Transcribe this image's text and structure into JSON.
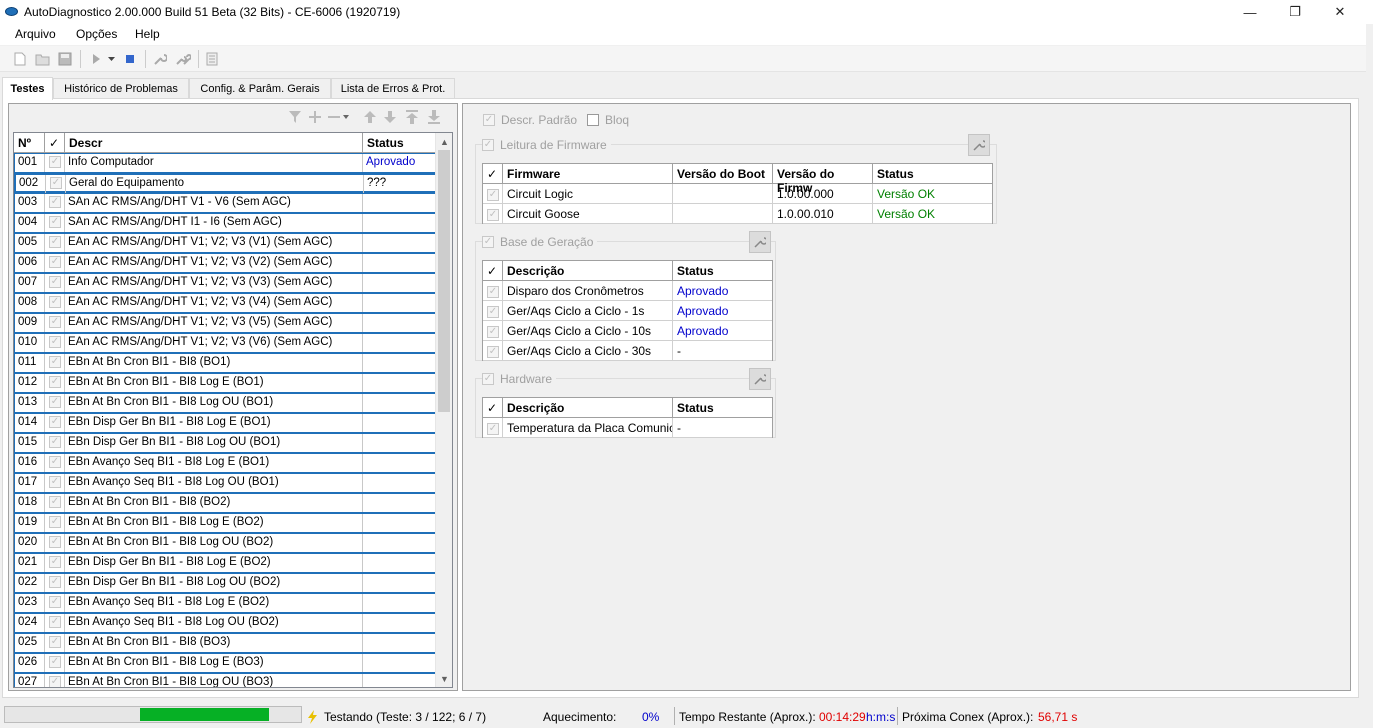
{
  "window": {
    "title": "AutoDiagnostico 2.00.000 Build 51 Beta (32 Bits) - CE-6006 (1920719)",
    "minimize": "—",
    "restore": "❐",
    "close": "✕"
  },
  "menu": [
    "Arquivo",
    "Opções",
    "Help"
  ],
  "toolbar_icons": [
    "new-icon",
    "open-icon",
    "save-icon",
    "play-icon",
    "dropdown-icon",
    "stop-icon",
    "wrench-icon",
    "wrench-multi-icon",
    "list-icon"
  ],
  "tabs": [
    "Testes",
    "Histórico de Problemas",
    "Config. & Parâm. Gerais",
    "Lista de Erros & Prot."
  ],
  "tests_grid": {
    "headers": {
      "num": "Nº",
      "check": "✓",
      "descr": "Descr",
      "status": "Status"
    },
    "rows": [
      {
        "num": "001",
        "descr": "Info Computador",
        "status": "Aprovado"
      },
      {
        "num": "002",
        "descr": "Geral do Equipamento",
        "status": "???"
      },
      {
        "num": "003",
        "descr": "SAn AC RMS/Ang/DHT V1 - V6 (Sem AGC)",
        "status": ""
      },
      {
        "num": "004",
        "descr": "SAn AC RMS/Ang/DHT I1 - I6 (Sem AGC)",
        "status": ""
      },
      {
        "num": "005",
        "descr": "EAn AC RMS/Ang/DHT V1; V2; V3 (V1) (Sem AGC)",
        "status": ""
      },
      {
        "num": "006",
        "descr": "EAn AC RMS/Ang/DHT V1; V2; V3 (V2) (Sem AGC)",
        "status": ""
      },
      {
        "num": "007",
        "descr": "EAn AC RMS/Ang/DHT V1; V2; V3 (V3) (Sem AGC)",
        "status": ""
      },
      {
        "num": "008",
        "descr": "EAn AC RMS/Ang/DHT V1; V2; V3 (V4) (Sem AGC)",
        "status": ""
      },
      {
        "num": "009",
        "descr": "EAn AC RMS/Ang/DHT V1; V2; V3 (V5) (Sem AGC)",
        "status": ""
      },
      {
        "num": "010",
        "descr": "EAn AC RMS/Ang/DHT V1; V2; V3 (V6) (Sem AGC)",
        "status": ""
      },
      {
        "num": "011",
        "descr": "EBn At Bn Cron BI1 - BI8 (BO1)",
        "status": ""
      },
      {
        "num": "012",
        "descr": "EBn At Bn Cron BI1 - BI8 Log E (BO1)",
        "status": ""
      },
      {
        "num": "013",
        "descr": "EBn At Bn Cron BI1 - BI8 Log OU (BO1)",
        "status": ""
      },
      {
        "num": "014",
        "descr": "EBn Disp Ger Bn BI1 - BI8 Log E (BO1)",
        "status": ""
      },
      {
        "num": "015",
        "descr": "EBn Disp Ger Bn BI1 - BI8 Log OU (BO1)",
        "status": ""
      },
      {
        "num": "016",
        "descr": "EBn Avanço Seq BI1 - BI8 Log E (BO1)",
        "status": ""
      },
      {
        "num": "017",
        "descr": "EBn Avanço Seq BI1 - BI8 Log OU (BO1)",
        "status": ""
      },
      {
        "num": "018",
        "descr": "EBn At Bn Cron BI1 - BI8 (BO2)",
        "status": ""
      },
      {
        "num": "019",
        "descr": "EBn At Bn Cron BI1 - BI8 Log E (BO2)",
        "status": ""
      },
      {
        "num": "020",
        "descr": "EBn At Bn Cron BI1 - BI8 Log OU (BO2)",
        "status": ""
      },
      {
        "num": "021",
        "descr": "EBn Disp Ger Bn BI1 - BI8 Log E (BO2)",
        "status": ""
      },
      {
        "num": "022",
        "descr": "EBn Disp Ger Bn BI1 - BI8 Log OU (BO2)",
        "status": ""
      },
      {
        "num": "023",
        "descr": "EBn Avanço Seq BI1 - BI8 Log E (BO2)",
        "status": ""
      },
      {
        "num": "024",
        "descr": "EBn Avanço Seq BI1 - BI8 Log OU (BO2)",
        "status": ""
      },
      {
        "num": "025",
        "descr": "EBn At Bn Cron BI1 - BI8 (BO3)",
        "status": ""
      },
      {
        "num": "026",
        "descr": "EBn At Bn Cron BI1 - BI8 Log E (BO3)",
        "status": ""
      },
      {
        "num": "027",
        "descr": "EBn At Bn Cron BI1 - BI8 Log OU (BO3)",
        "status": ""
      }
    ]
  },
  "options": {
    "descr_padrao": "Descr. Padrão",
    "bloq": "Bloq"
  },
  "firmware": {
    "title": "Leitura de Firmware",
    "headers": {
      "check": "✓",
      "name": "Firmware",
      "boot": "Versão do Boot",
      "fw": "Versão do Firmw",
      "status": "Status"
    },
    "rows": [
      {
        "name": "Circuit Logic",
        "boot": "",
        "fw": "1.0.00.000",
        "status": "Versão OK"
      },
      {
        "name": "Circuit Goose",
        "boot": "",
        "fw": "1.0.00.010",
        "status": "Versão OK"
      }
    ]
  },
  "geracao": {
    "title": "Base de Geração",
    "headers": {
      "check": "✓",
      "descr": "Descrição",
      "status": "Status"
    },
    "rows": [
      {
        "descr": "Disparo dos Cronômetros",
        "status": "Aprovado"
      },
      {
        "descr": "Ger/Aqs Ciclo a Ciclo - 1s",
        "status": "Aprovado"
      },
      {
        "descr": "Ger/Aqs Ciclo a Ciclo - 10s",
        "status": "Aprovado"
      },
      {
        "descr": "Ger/Aqs Ciclo a Ciclo - 30s",
        "status": "-"
      }
    ]
  },
  "hardware": {
    "title": "Hardware",
    "headers": {
      "check": "✓",
      "descr": "Descrição",
      "status": "Status"
    },
    "rows": [
      {
        "descr": "Temperatura da Placa Comunic.",
        "status": "-"
      }
    ]
  },
  "statusbar": {
    "progress": 0.43,
    "testing": "Testando (Teste: 3 / 122; 6 / 7)",
    "aquecimento_label": "Aquecimento:",
    "aquecimento_value": "0%",
    "tempo_label": "Tempo Restante (Aprox.):",
    "tempo_value": "00:14:29",
    "tempo_unit": "h:m:s",
    "conex_label": "Próxima Conex (Aprox.):",
    "conex_value": "56,71 s"
  },
  "colors": {
    "approved": "#0000cc",
    "ok": "#008000",
    "red": "#e00000",
    "accent": "#1f6fb8"
  }
}
